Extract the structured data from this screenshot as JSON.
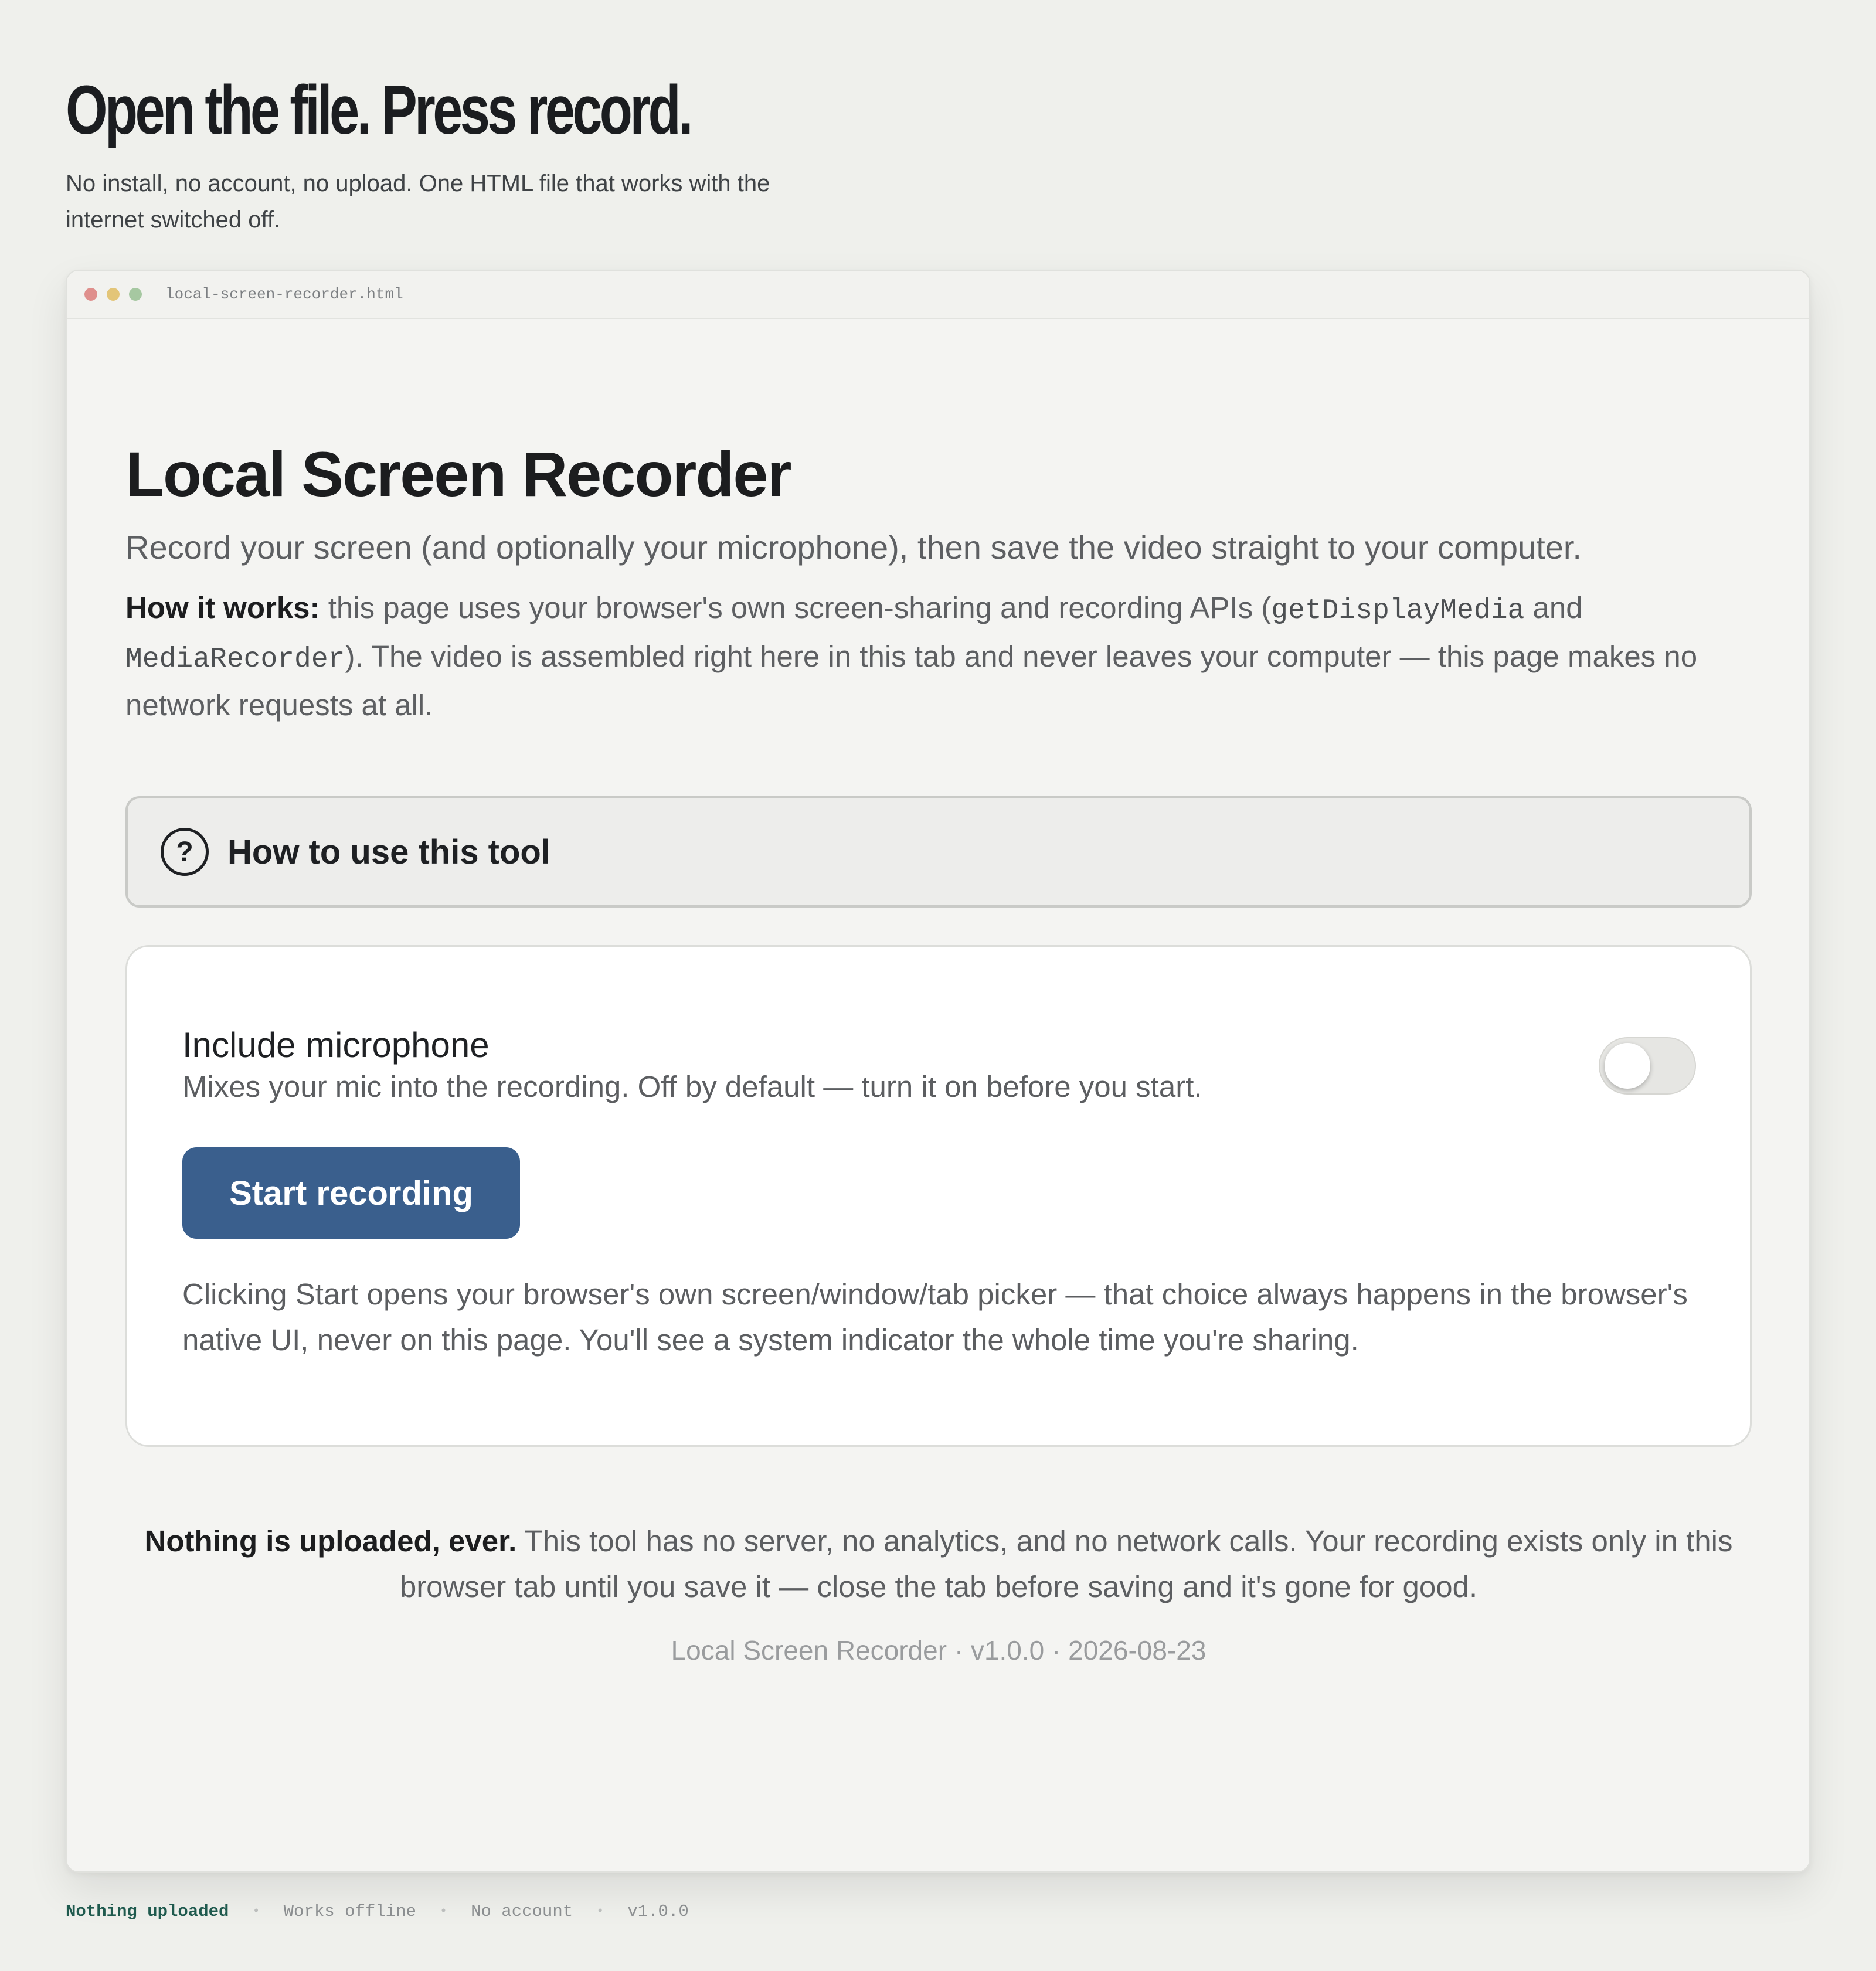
{
  "hero": {
    "title": "Open the file. Press record.",
    "subtitle": "No install, no account, no upload. One HTML file that works with the internet switched off."
  },
  "window": {
    "filename": "local-screen-recorder.html"
  },
  "app": {
    "title": "Local Screen Recorder",
    "subtitle": "Record your screen (and optionally your microphone), then save the video straight to your computer.",
    "how_it_works": {
      "label": "How it works:",
      "text1": " this page uses your browser's own screen-sharing and recording APIs (",
      "api1": "getDisplayMedia",
      "text2": " and ",
      "api2": "MediaRecorder",
      "text3": "). The video is assembled right here in this tab and never leaves your computer — this page makes no network requests at all."
    },
    "howto_label": "How to use this tool",
    "help_icon_glyph": "?",
    "mic": {
      "title": "Include microphone",
      "description": "Mixes your mic into the recording. Off by default — turn it on before you start.",
      "enabled": false
    },
    "start_label": "Start recording",
    "picker_note": "Clicking Start opens your browser's own screen/window/tab picker — that choice always happens in the browser's native UI, never on this page. You'll see a system indicator the whole time you're sharing.",
    "upload_note": {
      "bold": "Nothing is uploaded, ever.",
      "text": " This tool has no server, no analytics, and no network calls. Your recording exists only in this browser tab until you save it — close the tab before saving and it's gone for good."
    },
    "version_line": "Local Screen Recorder · v1.0.0 · 2026-08-23"
  },
  "footer": {
    "items": [
      "Nothing uploaded",
      "Works offline",
      "No account",
      "v1.0.0"
    ],
    "separator": "•"
  },
  "colors": {
    "background": "#eff0ec",
    "accent_button": "#3a5f8d",
    "footer_highlight": "#1f5a4e"
  }
}
